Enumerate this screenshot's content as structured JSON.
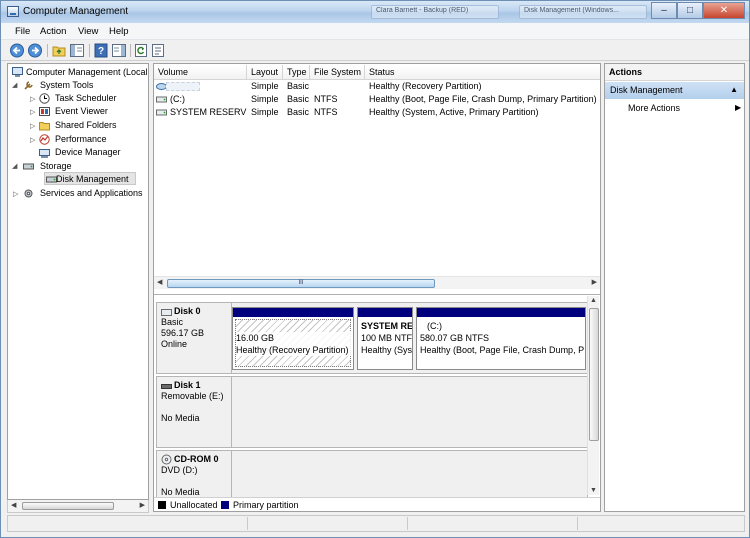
{
  "window": {
    "title": "Computer Management",
    "bg_tab_1": "Clara Barnett - Backup (RED)",
    "bg_tab_2": "Disk Management (Windows...",
    "min": "–",
    "max": "□",
    "close": "✕"
  },
  "menu": [
    "File",
    "Action",
    "View",
    "Help"
  ],
  "tree": {
    "root": "Computer Management (Local",
    "system_tools": "System Tools",
    "task_scheduler": "Task Scheduler",
    "event_viewer": "Event Viewer",
    "shared_folders": "Shared Folders",
    "performance": "Performance",
    "device_manager": "Device Manager",
    "storage": "Storage",
    "disk_management": "Disk Management",
    "services": "Services and Applications"
  },
  "columns": [
    "Volume",
    "Layout",
    "Type",
    "File System",
    "Status"
  ],
  "volumes": [
    {
      "volume": "",
      "layout": "Simple",
      "type": "Basic",
      "fs": "",
      "status": "Healthy (Recovery Partition)"
    },
    {
      "volume": "(C:)",
      "layout": "Simple",
      "type": "Basic",
      "fs": "NTFS",
      "status": "Healthy (Boot, Page File, Crash Dump, Primary Partition)"
    },
    {
      "volume": "SYSTEM RESERVED",
      "layout": "Simple",
      "type": "Basic",
      "fs": "NTFS",
      "status": "Healthy (System, Active, Primary Partition)"
    }
  ],
  "scroll_grip": "III",
  "disks": [
    {
      "name": "Disk 0",
      "line1": "Basic",
      "line2": "596.17 GB",
      "line3": "Online"
    },
    {
      "name": "Disk 1",
      "line1": "Removable (E:)",
      "line2": "",
      "line3": "No Media"
    },
    {
      "name": "CD-ROM 0",
      "line1": "DVD (D:)",
      "line2": "",
      "line3": "No Media"
    }
  ],
  "partitions": [
    {
      "title": "",
      "size": "16.00 GB",
      "status": "Healthy (Recovery Partition)"
    },
    {
      "title": "SYSTEM RE",
      "size": "100 MB NTF",
      "status": "Healthy (Sys"
    },
    {
      "title": "(C:)",
      "size": "580.07 GB NTFS",
      "status": "Healthy (Boot, Page File, Crash Dump, P"
    }
  ],
  "legend": {
    "unallocated": "Unallocated",
    "unallocated_color": "#000000",
    "primary": "Primary partition",
    "primary_color": "#00007f"
  },
  "actions": {
    "header": "Actions",
    "section": "Disk Management",
    "more": "More Actions"
  }
}
